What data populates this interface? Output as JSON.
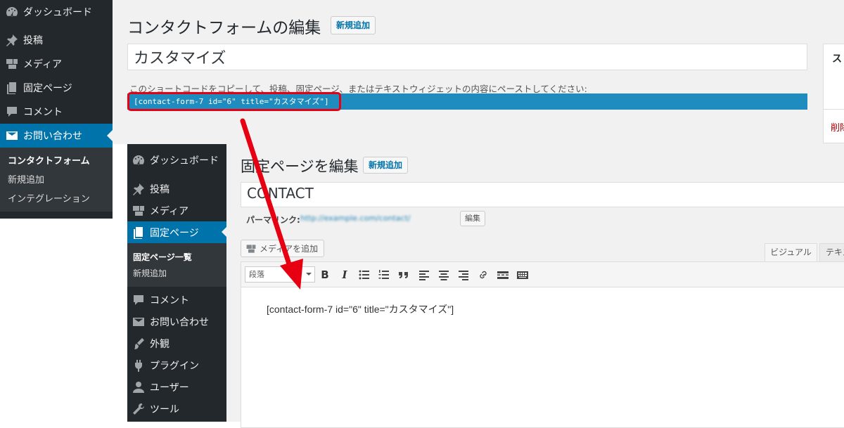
{
  "form_editor": {
    "sidebar": {
      "items": [
        {
          "label": "ダッシュボード",
          "icon": "dashboard-icon"
        },
        {
          "label": "投稿",
          "icon": "pin-icon"
        },
        {
          "label": "メディア",
          "icon": "media-icon"
        },
        {
          "label": "固定ページ",
          "icon": "page-icon"
        },
        {
          "label": "コメント",
          "icon": "comment-icon"
        },
        {
          "label": "お問い合わせ",
          "icon": "mail-icon"
        }
      ],
      "submenu": [
        "コンタクトフォーム",
        "新規追加",
        "インテグレーション"
      ]
    },
    "title": "コンタクトフォームの編集",
    "add_new_label": "新規追加",
    "form_title_value": "カスタマイズ",
    "shortcode_hint": "このショートコードをコピーして、投稿、固定ページ、またはテキストウィジェットの内容にペーストしてください:",
    "shortcode": "[contact-form-7 id=\"6\" title=\"カスタマイズ\"]",
    "right_box": {
      "heading_partial": "ス",
      "delete_partial": "削除"
    }
  },
  "page_editor": {
    "sidebar": {
      "items_top": [
        {
          "label": "ダッシュボード",
          "icon": "dashboard-icon"
        },
        {
          "label": "投稿",
          "icon": "pin-icon"
        },
        {
          "label": "メディア",
          "icon": "media-icon"
        },
        {
          "label": "固定ページ",
          "icon": "page-icon"
        }
      ],
      "submenu": [
        "固定ページ一覧",
        "新規追加"
      ],
      "items_bottom": [
        {
          "label": "コメント",
          "icon": "comment-icon"
        },
        {
          "label": "お問い合わせ",
          "icon": "mail-icon"
        },
        {
          "label": "外観",
          "icon": "brush-icon"
        },
        {
          "label": "プラグイン",
          "icon": "plugin-icon"
        },
        {
          "label": "ユーザー",
          "icon": "user-icon"
        },
        {
          "label": "ツール",
          "icon": "wrench-icon"
        }
      ]
    },
    "title": "固定ページを編集",
    "add_new_label": "新規追加",
    "page_title_value": "CONTACT",
    "permalink_label": "パーマリンク:",
    "permalink_url": "http://example.com/contact/",
    "permalink_edit_label": "編集",
    "add_media_label": "メディアを追加",
    "tab_visual": "ビジュアル",
    "tab_text": "テキスト",
    "format_select_value": "段落",
    "toolbar_icons": [
      "bold-icon",
      "italic-icon",
      "bullet-list-icon",
      "numbered-list-icon",
      "quote-icon",
      "align-left-icon",
      "align-center-icon",
      "align-right-icon",
      "link-icon",
      "more-tag-icon",
      "toolbar-toggle-icon"
    ],
    "editor_content": "[contact-form-7 id=\"6\" title=\"カスタマイズ\"]"
  },
  "colors": {
    "admin_blue": "#0073aa",
    "sidebar_dark": "#23282d",
    "highlight_red": "#e60012"
  }
}
